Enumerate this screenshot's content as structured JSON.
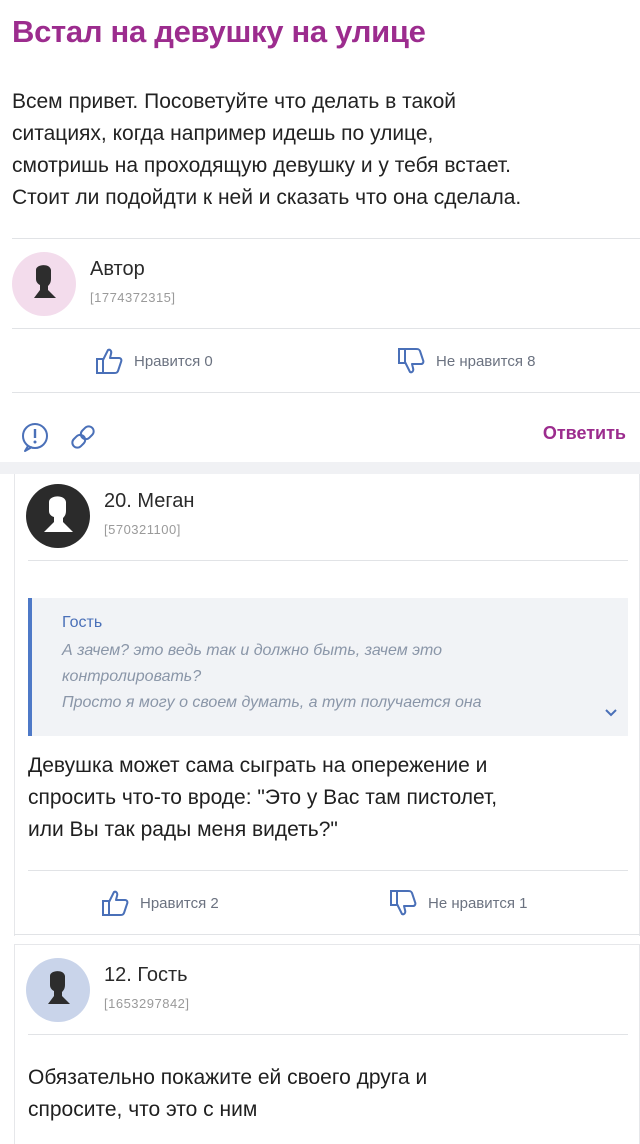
{
  "post": {
    "title": "Встал на девушку на улице",
    "lines": [
      "Всем привет. Посоветуйте что делать в такой",
      "ситациях, когда например идешь по улице,",
      "смотришь на проходящую девушку и у тебя встает.",
      "Стоит ли подойдти к ней и сказать что она сделала."
    ],
    "author": {
      "name": "Автор",
      "id": "[1774372315]"
    },
    "likes": "Нравится 0",
    "dislikes": "Не нравится 8",
    "reply": "Ответить"
  },
  "comments": [
    {
      "name": "20. Меган",
      "id": "[570321100]",
      "quote": {
        "author": "Гость",
        "lines": [
          "А зачем? это ведь так и должно быть, зачем это",
          "контролировать?",
          "Просто я могу о своем думать, а тут получается она"
        ]
      },
      "lines": [
        "Девушка может сама сыграть на опережение и",
        "спросить что-то вроде: \"Это у Вас там пистолет,",
        "или Вы так рады меня видеть?\""
      ],
      "likes": "Нравится 2",
      "dislikes": "Не нравится 1"
    },
    {
      "name": "12. Гость",
      "id": "[1653297842]",
      "lines": [
        "Обязательно покажите ей своего друга и",
        "спросите, что это с ним"
      ]
    }
  ],
  "icons": {
    "like": "thumbs-up-icon",
    "dislike": "thumbs-down-icon",
    "report": "exclamation-icon",
    "link": "link-icon",
    "expand": "chevron-down-icon",
    "avatar": "user-silhouette-icon"
  },
  "colors": {
    "accent": "#9c2c8e",
    "quote_bar": "#4e79c7",
    "avatar_author": "#f3dcec",
    "avatar_megan": "#2b2b2b",
    "avatar_guest": "#c9d4ea"
  }
}
